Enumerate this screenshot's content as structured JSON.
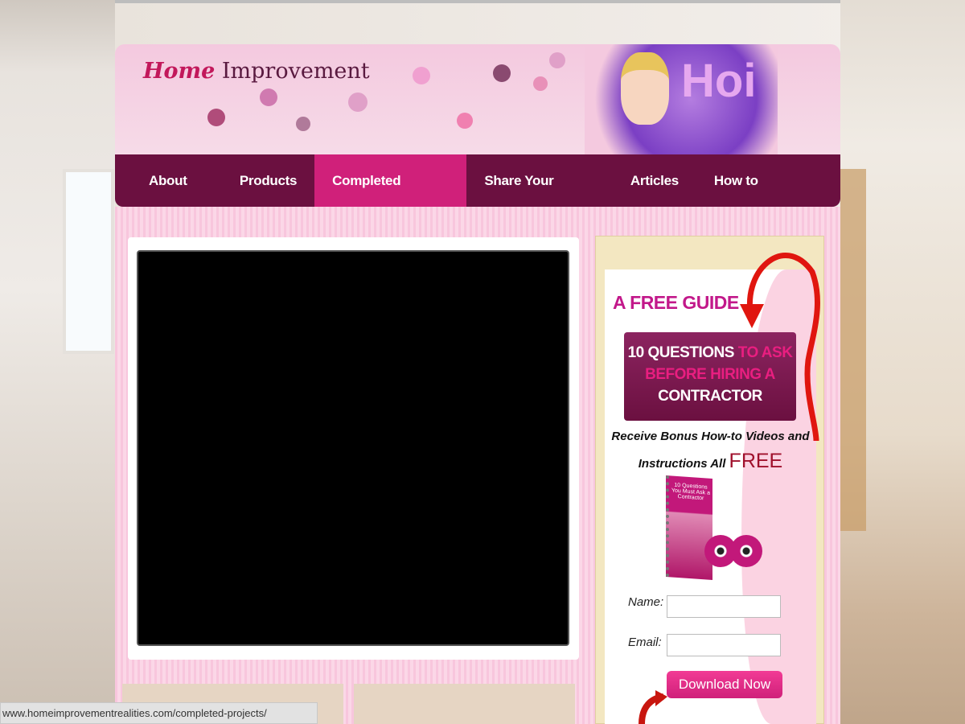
{
  "logo": {
    "brand": "Home",
    "rest": "Improvement"
  },
  "banner": {
    "partial_text": "Hoi"
  },
  "nav": {
    "items": [
      {
        "label": "About Us"
      },
      {
        "label": "Products"
      },
      {
        "label": "Completed Projects",
        "active": true
      },
      {
        "label": "Share Your Project"
      },
      {
        "label": "Articles"
      },
      {
        "label": "How to Resources"
      }
    ]
  },
  "optin": {
    "title": "A FREE GUIDE",
    "q1": "10 QUESTIONS ",
    "q2": "TO ASK",
    "q3": "BEFORE HIRING A",
    "q4": "CONTRACTOR",
    "bonus_line1": "Receive Bonus How-to Videos and",
    "bonus_line2": "Instructions All ",
    "bonus_free": "FREE",
    "book_title": "10 Questions You Must Ask a Contractor",
    "name_label": "Name:",
    "name_value": "",
    "email_label": "Email:",
    "email_value": "",
    "button": "Download Now"
  },
  "status_bar": {
    "url": "www.homeimprovementrealities.com/completed-projects/"
  },
  "colors": {
    "nav_bg": "#6b1040",
    "nav_active": "#d0207a",
    "accent": "#c2188a"
  }
}
